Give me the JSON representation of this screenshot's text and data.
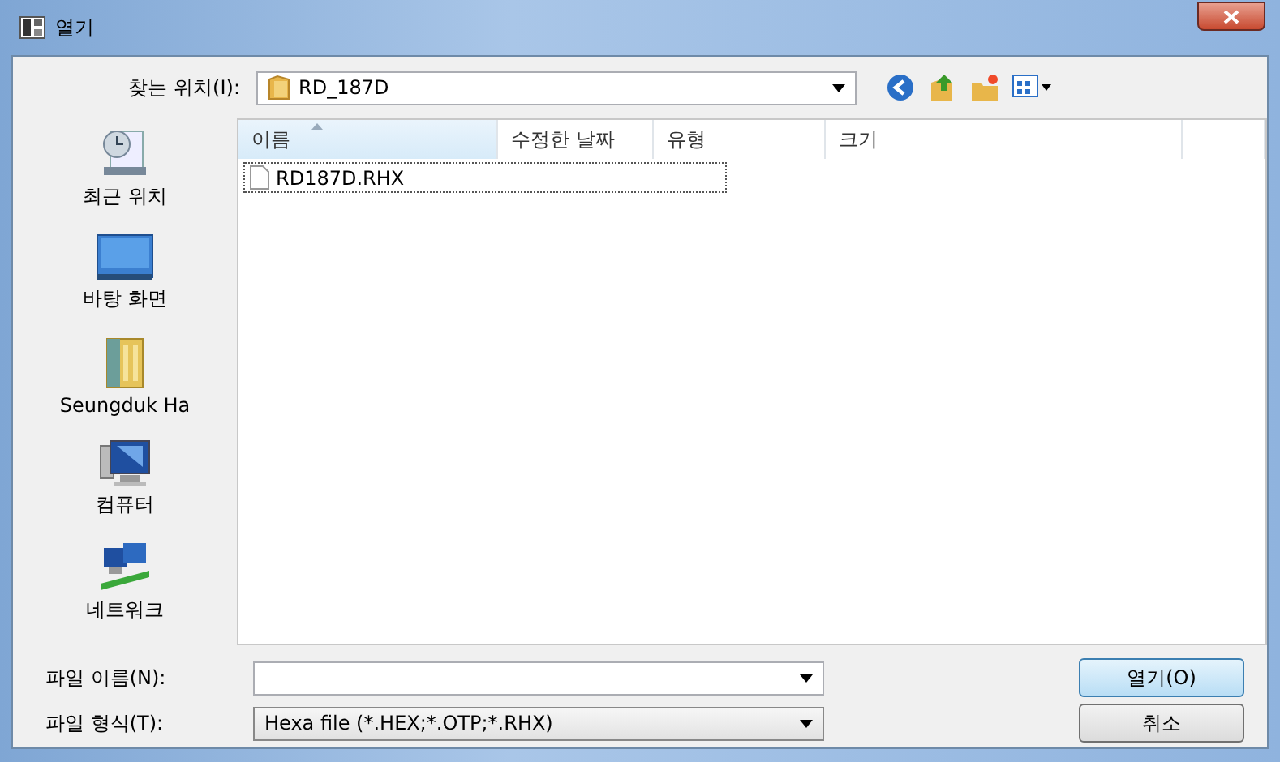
{
  "window": {
    "title": "열기"
  },
  "look_in": {
    "label": "찾는 위치(I):",
    "value": "RD_187D"
  },
  "places": [
    {
      "label": "최근 위치",
      "kind": "recent"
    },
    {
      "label": "바탕 화면",
      "kind": "desktop"
    },
    {
      "label": "Seungduk Ha",
      "kind": "user"
    },
    {
      "label": "컴퓨터",
      "kind": "computer"
    },
    {
      "label": "네트워크",
      "kind": "network"
    }
  ],
  "table": {
    "columns": [
      "이름",
      "수정한 날짜",
      "유형",
      "크기"
    ],
    "rows": [
      {
        "name": "RD187D.RHX",
        "focused": true
      }
    ]
  },
  "file_name": {
    "label": "파일 이름(N):"
  },
  "file_type": {
    "label": "파일 형식(T):",
    "value": "Hexa file (*.HEX;*.OTP;*.RHX)"
  },
  "buttons": [
    "열기(O)",
    "취소"
  ]
}
